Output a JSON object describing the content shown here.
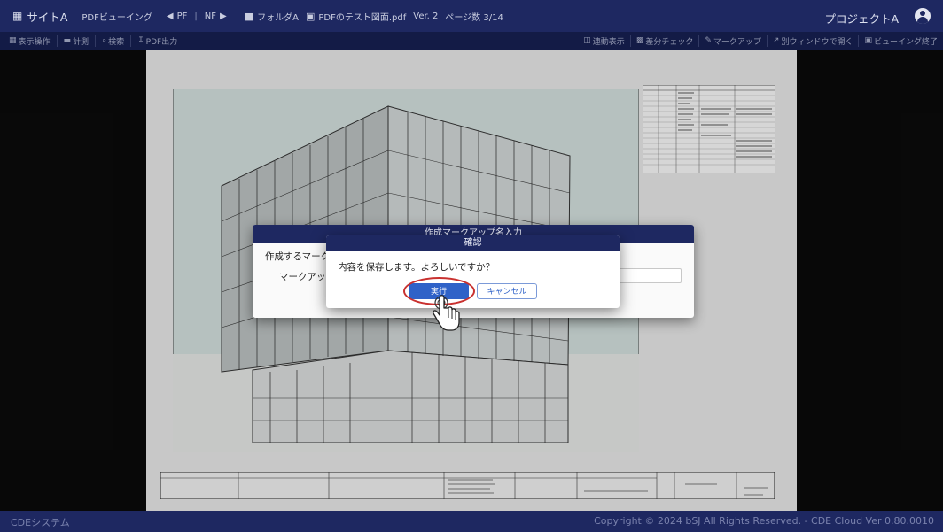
{
  "header": {
    "site": "サイトA",
    "app": "PDFビューイング",
    "prev": "PF",
    "next": "NF",
    "folder": "フォルダA",
    "file": "PDFのテスト図面.pdf",
    "version": "Ver. 2",
    "page_info": "ページ数 3/14",
    "project": "プロジェクトA"
  },
  "toolbar": {
    "left": [
      "表示操作",
      "計測",
      "検索",
      "PDF出力"
    ],
    "right": [
      "連動表示",
      "差分チェック",
      "マークアップ",
      "別ウィンドウで開く",
      "ビューイング終了"
    ]
  },
  "dialog_bg": {
    "title": "作成マークアップ名入力",
    "label_1": "作成するマークア",
    "label_2": "マークアップ"
  },
  "dialog_confirm": {
    "title": "確認",
    "message": "内容を保存します。よろしいですか？",
    "ok_label": "実行",
    "cancel_label": "キャンセル"
  },
  "footer": {
    "system": "CDEシステム",
    "copyright": "Copyright © 2024 bSJ All Rights Reserved. - CDE Cloud Ver 0.80.0010"
  },
  "colors": {
    "header": "#1e2861",
    "toolbar": "#161f50",
    "primary_button": "#2f62c8",
    "highlight": "#c9312f"
  }
}
